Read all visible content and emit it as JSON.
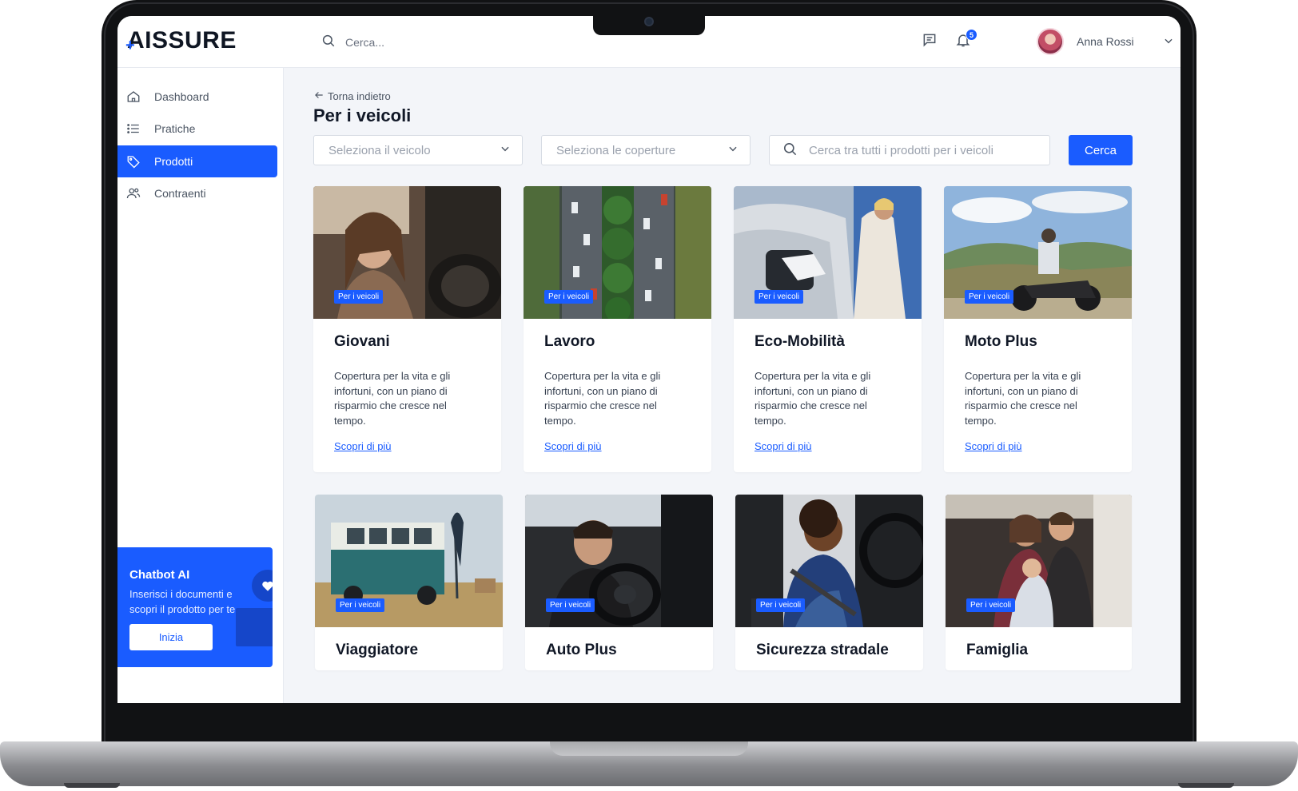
{
  "app": {
    "logo": "AISSURE",
    "logo_mark": "+"
  },
  "header": {
    "search_placeholder": "Cerca...",
    "notifications_count": "5",
    "user_name": "Anna Rossi"
  },
  "sidebar": {
    "items": [
      {
        "label": "Dashboard",
        "icon": "home-icon"
      },
      {
        "label": "Pratiche",
        "icon": "list-icon"
      },
      {
        "label": "Prodotti",
        "icon": "tag-icon",
        "active": true
      },
      {
        "label": "Contraenti",
        "icon": "users-icon"
      }
    ],
    "chatbot": {
      "title": "Chatbot AI",
      "description": "Inserisci i documenti e scopri il prodotto per te",
      "button": "Inizia"
    }
  },
  "main": {
    "back_label": "Torna indietro",
    "title": "Per i veicoli",
    "filters": {
      "vehicle_placeholder": "Seleziona il veicolo",
      "coverage_placeholder": "Seleziona le coperture",
      "search_placeholder": "Cerca tra tutti i prodotti per i veicoli",
      "search_button": "Cerca"
    },
    "cards": [
      {
        "tag": "Per i veicoli",
        "title": "Giovani",
        "description": "Copertura per la vita e gli infortuni, con un piano di risparmio che cresce nel tempo.",
        "link": "Scopri di più"
      },
      {
        "tag": "Per i veicoli",
        "title": "Lavoro",
        "description": "Copertura per la vita e gli infortuni, con un piano di risparmio che cresce nel tempo.",
        "link": "Scopri di più"
      },
      {
        "tag": "Per i veicoli",
        "title": "Eco-Mobilità",
        "description": "Copertura per la vita e gli infortuni, con un piano di risparmio che cresce nel tempo.",
        "link": "Scopri di più"
      },
      {
        "tag": "Per i veicoli",
        "title": "Moto Plus",
        "description": "Copertura per la vita e gli infortuni, con un piano di risparmio che cresce nel tempo.",
        "link": "Scopri di più"
      },
      {
        "tag": "Per i veicoli",
        "title": "Viaggiatore"
      },
      {
        "tag": "Per i veicoli",
        "title": "Auto Plus"
      },
      {
        "tag": "Per i veicoli",
        "title": "Sicurezza stradale"
      },
      {
        "tag": "Per i veicoli",
        "title": "Famiglia"
      }
    ]
  },
  "colors": {
    "accent": "#1a5cff",
    "background": "#f3f5f9",
    "text": "#111827"
  }
}
